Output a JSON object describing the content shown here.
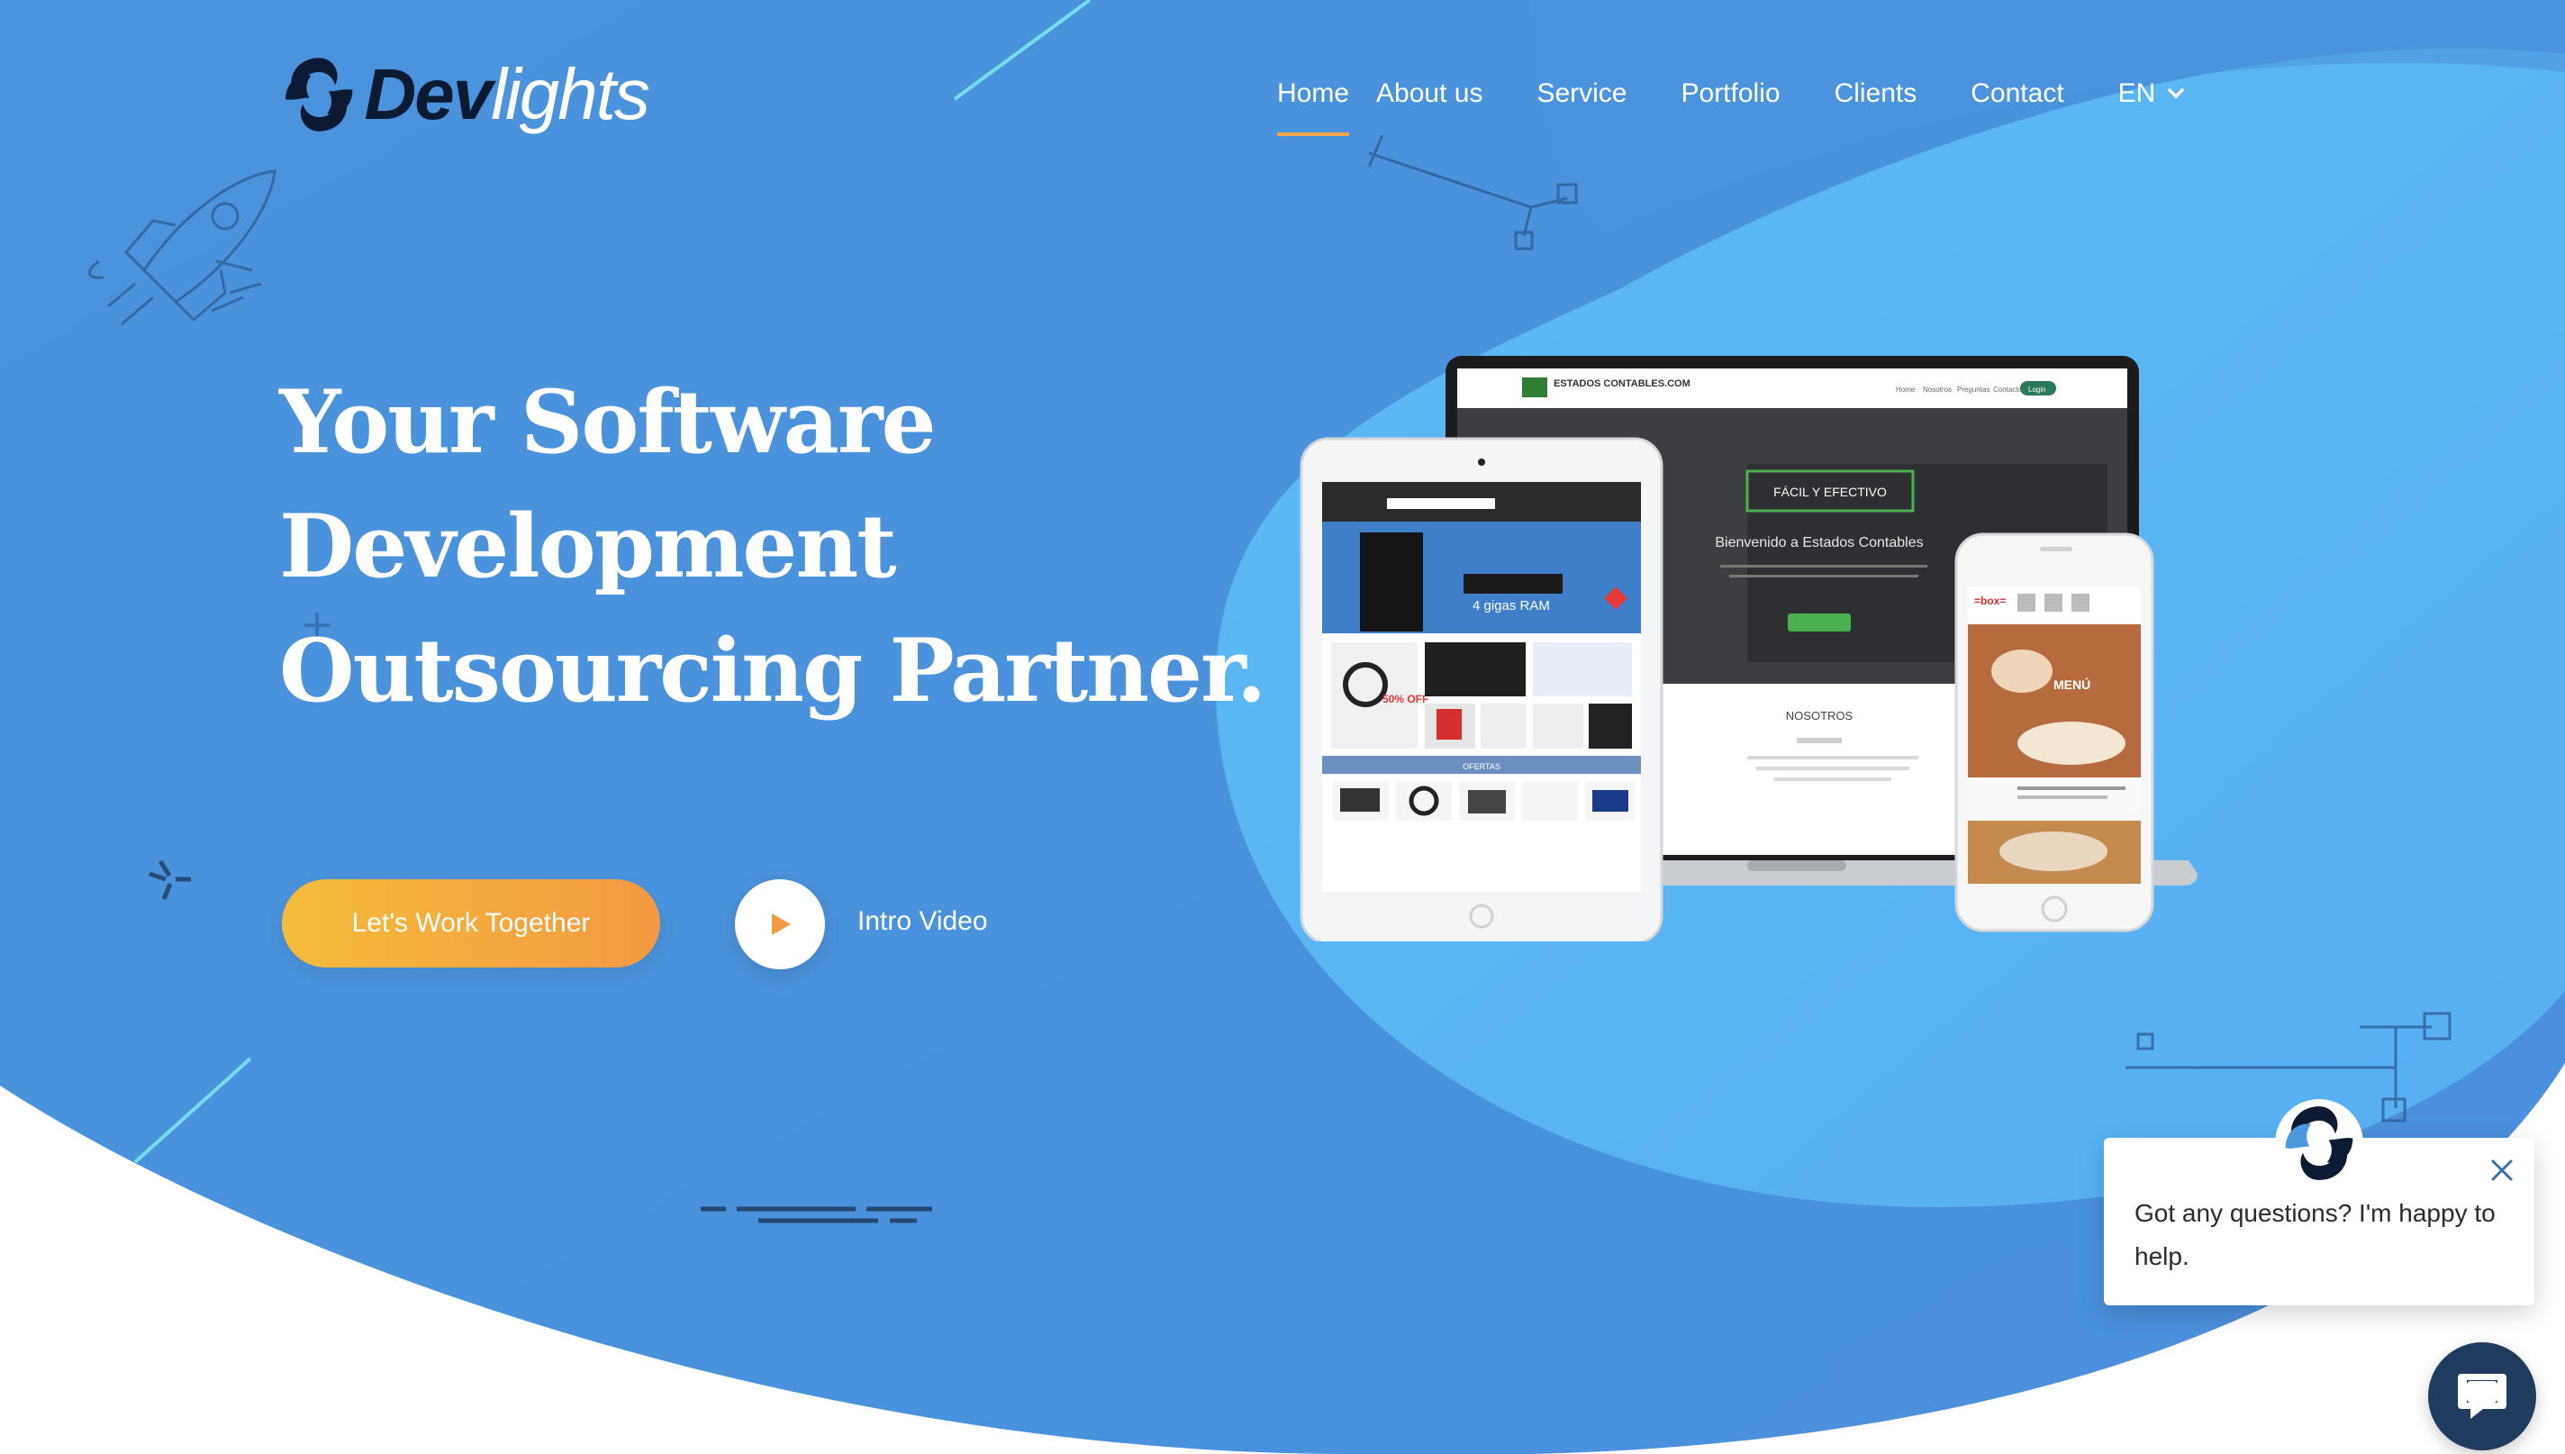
{
  "brand": {
    "logo_text_dark": "Dev",
    "logo_text_light": "lights",
    "colors": {
      "primary_blue": "#4d97df",
      "light_blue": "#5cb7f4",
      "accent_orange": "#f29a43",
      "accent_yellow": "#f5bc3a",
      "navy": "#1f3c5f"
    }
  },
  "nav": {
    "items": [
      {
        "label": "Home",
        "active": true
      },
      {
        "label": "About us",
        "active": false
      },
      {
        "label": "Service",
        "active": false
      },
      {
        "label": "Portfolio",
        "active": false
      },
      {
        "label": "Clients",
        "active": false
      },
      {
        "label": "Contact",
        "active": false
      }
    ],
    "language": "EN",
    "language_icon": "chevron-down-icon"
  },
  "hero": {
    "title_lines": [
      "Your Software",
      "Development",
      "Outsourcing Partner."
    ],
    "cta_label": "Let's Work Together",
    "video_label": "Intro Video",
    "video_icon": "play-icon"
  },
  "mockups": {
    "laptop_site_logo": "ESTADOS CONTABLES.COM",
    "laptop_nav": [
      "Home",
      "Nosotros",
      "Preguntas",
      "Contacto",
      "Login"
    ],
    "laptop_badge": "FÁCIL Y EFECTIVO",
    "laptop_heading": "Bienvenido a Estados Contables",
    "laptop_section": "NOSOTROS",
    "tablet_banner": "4 gigas RAM",
    "tablet_sale": "50% OFF",
    "tablet_offers": "OFERTAS",
    "phone_brand": "=box=",
    "phone_menu": "MENÚ"
  },
  "chat": {
    "message": "Got any questions? I'm happy to help.",
    "close_icon": "close-icon",
    "launcher_icon": "chat-bubble-icon"
  }
}
